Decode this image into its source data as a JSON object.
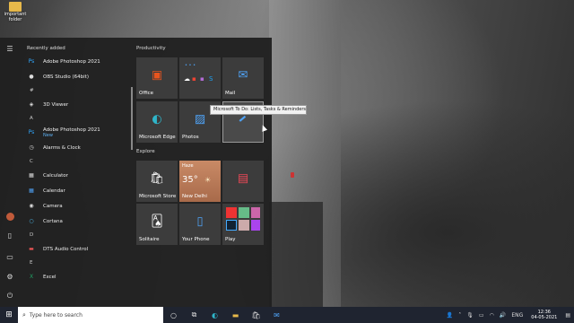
{
  "desktop": {
    "icon_label": "important folder"
  },
  "start": {
    "recently_added": "Recently added",
    "apps": [
      {
        "kind": "item",
        "label": "Adobe Photoshop 2021",
        "icon": "Ps",
        "color": "#31a8ff"
      },
      {
        "kind": "item",
        "label": "OBS Studio (64bit)",
        "icon": "●",
        "color": "#ddd"
      },
      {
        "kind": "letter",
        "label": "#"
      },
      {
        "kind": "item",
        "label": "3D Viewer",
        "icon": "◈",
        "color": "#ddd"
      },
      {
        "kind": "letter",
        "label": "A"
      },
      {
        "kind": "item",
        "label": "Adobe Photoshop 2021",
        "icon": "Ps",
        "color": "#31a8ff",
        "badge": "New"
      },
      {
        "kind": "item",
        "label": "Alarms & Clock",
        "icon": "◷",
        "color": "#ddd"
      },
      {
        "kind": "letter",
        "label": "C"
      },
      {
        "kind": "item",
        "label": "Calculator",
        "icon": "▦",
        "color": "#ddd"
      },
      {
        "kind": "item",
        "label": "Calendar",
        "icon": "▦",
        "color": "#4fa3f7"
      },
      {
        "kind": "item",
        "label": "Camera",
        "icon": "◉",
        "color": "#ddd"
      },
      {
        "kind": "item",
        "label": "Cortana",
        "icon": "○",
        "color": "#4fc3f7"
      },
      {
        "kind": "letter",
        "label": "D"
      },
      {
        "kind": "item",
        "label": "DTS Audio Control",
        "icon": "▬",
        "color": "#e55"
      },
      {
        "kind": "letter",
        "label": "E"
      },
      {
        "kind": "item",
        "label": "Excel",
        "icon": "X",
        "color": "#21a366"
      }
    ],
    "groups": {
      "productivity": "Productivity",
      "explore": "Explore"
    },
    "tiles": {
      "office": "Office",
      "mail": "Mail",
      "edge": "Microsoft Edge",
      "photos": "Photos",
      "store": "Microsoft Store",
      "weather_condition": "Haze",
      "weather_temp": "35°",
      "weather_city": "New Delhi",
      "solitaire": "Solitaire",
      "your_phone": "Your Phone",
      "play": "Play"
    },
    "tooltip": "Microsoft To Do: Lists, Tasks & Reminders"
  },
  "taskbar": {
    "search_placeholder": "Type here to search",
    "lang": "ENG",
    "time": "12:36",
    "date": "04-05-2021"
  }
}
